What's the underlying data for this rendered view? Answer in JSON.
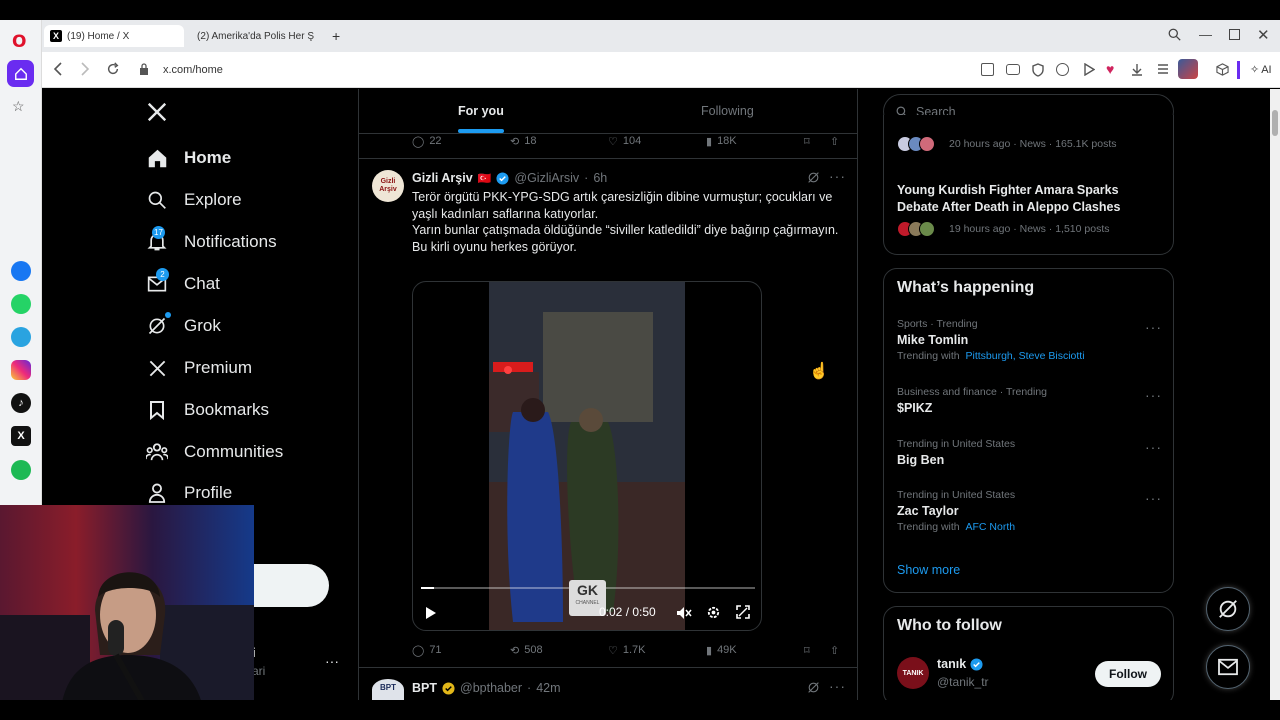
{
  "browser": {
    "tabs": [
      {
        "title": "(19) Home / X",
        "active": true
      },
      {
        "title": "(2) Amerika'da Polis Her Ş",
        "active": false
      }
    ],
    "url": "x.com/home",
    "ai_label": "AI"
  },
  "nav": {
    "items": [
      {
        "label": "Home",
        "icon": "home-icon"
      },
      {
        "label": "Explore",
        "icon": "search-icon"
      },
      {
        "label": "Notifications",
        "icon": "bell-icon",
        "badge": "17"
      },
      {
        "label": "Chat",
        "icon": "mail-icon",
        "badge": "2"
      },
      {
        "label": "Grok",
        "icon": "grok-icon"
      },
      {
        "label": "Premium",
        "icon": "x-logo-icon"
      },
      {
        "label": "Bookmarks",
        "icon": "bookmark-icon"
      },
      {
        "label": "Communities",
        "icon": "communities-icon"
      },
      {
        "label": "Profile",
        "icon": "profile-icon"
      }
    ],
    "account_name_partial": "i",
    "account_handle_partial": "ari"
  },
  "feed": {
    "tabs": [
      "For you",
      "Following"
    ],
    "prev_actions": {
      "replies": "22",
      "reposts": "18",
      "likes": "104",
      "views": "18K"
    },
    "tweet": {
      "name": "Gizli Arşiv",
      "flag": "🇹🇷",
      "handle": "@GizliArsiv",
      "time": "6h",
      "avatar_text": "Gizli\nArşiv",
      "lines": [
        "Terör örgütü PKK-YPG-SDG artık çaresizliğin dibine vurmuştur; çocukları ve yaşlı kadınları saflarına katıyorlar.",
        "Yarın bunlar çatışmada öldüğünde “siviller katledildi” diye bağırıp çağırmayın.",
        "Bu kirli oyunu herkes görüyor."
      ],
      "video": {
        "time": "0:02 / 0:50",
        "watermark": "GK",
        "watermark_sub": "CHANNEL",
        "progress": 0.04
      },
      "actions": {
        "replies": "71",
        "reposts": "508",
        "likes": "1.7K",
        "views": "49K"
      }
    },
    "next_tweet": {
      "name": "BPT",
      "handle": "@bpthaber",
      "time": "42m",
      "avatar_text": "BPT"
    }
  },
  "right": {
    "search_placeholder": "Search",
    "news": [
      {
        "title": "",
        "meta": "20 hours ago · News · 165.1K posts"
      },
      {
        "title": "Young Kurdish Fighter Amara Sparks Debate After Death in Aleppo Clashes",
        "meta": "19 hours ago · News · 1,510 posts"
      }
    ],
    "happening_title": "What’s happening",
    "trends": [
      {
        "category": "Sports · Trending",
        "name": "Mike Tomlin",
        "with_label": "Trending with",
        "with": "Pittsburgh, Steve Bisciotti"
      },
      {
        "category": "Business and finance · Trending",
        "name": "$PIKZ",
        "with_label": "",
        "with": ""
      },
      {
        "category": "Trending in United States",
        "name": "Big Ben",
        "with_label": "",
        "with": ""
      },
      {
        "category": "Trending in United States",
        "name": "Zac Taylor",
        "with_label": "Trending with",
        "with": "AFC North"
      }
    ],
    "show_more": "Show more",
    "who_title": "Who to follow",
    "follow": {
      "name": "tanık",
      "handle": "@tanik_tr",
      "avatar_text": "TANIK",
      "button": "Follow"
    }
  },
  "colors": {
    "accent": "#1d9bf0",
    "bg": "#000000",
    "border": "#2f3336",
    "muted": "#71767b"
  }
}
